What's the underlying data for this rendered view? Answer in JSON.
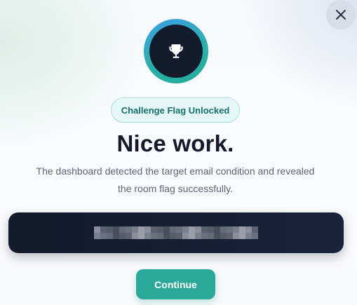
{
  "dialog": {
    "close_icon": "close-icon",
    "trophy_icon": "trophy-icon",
    "badge_label": "Challenge Flag Unlocked",
    "heading": "Nice work.",
    "description": "The dashboard detected the target email condition and revealed the room flag successfully.",
    "flag": {
      "value": "",
      "state": "obscured"
    },
    "continue_label": "Continue"
  },
  "colors": {
    "accent": "#2ba89a",
    "dark": "#141b2d",
    "badge_text": "#15706d",
    "badge_bg": "#e6f7f8",
    "ring_start": "#3aa0e6",
    "ring_end": "#25a89c"
  }
}
